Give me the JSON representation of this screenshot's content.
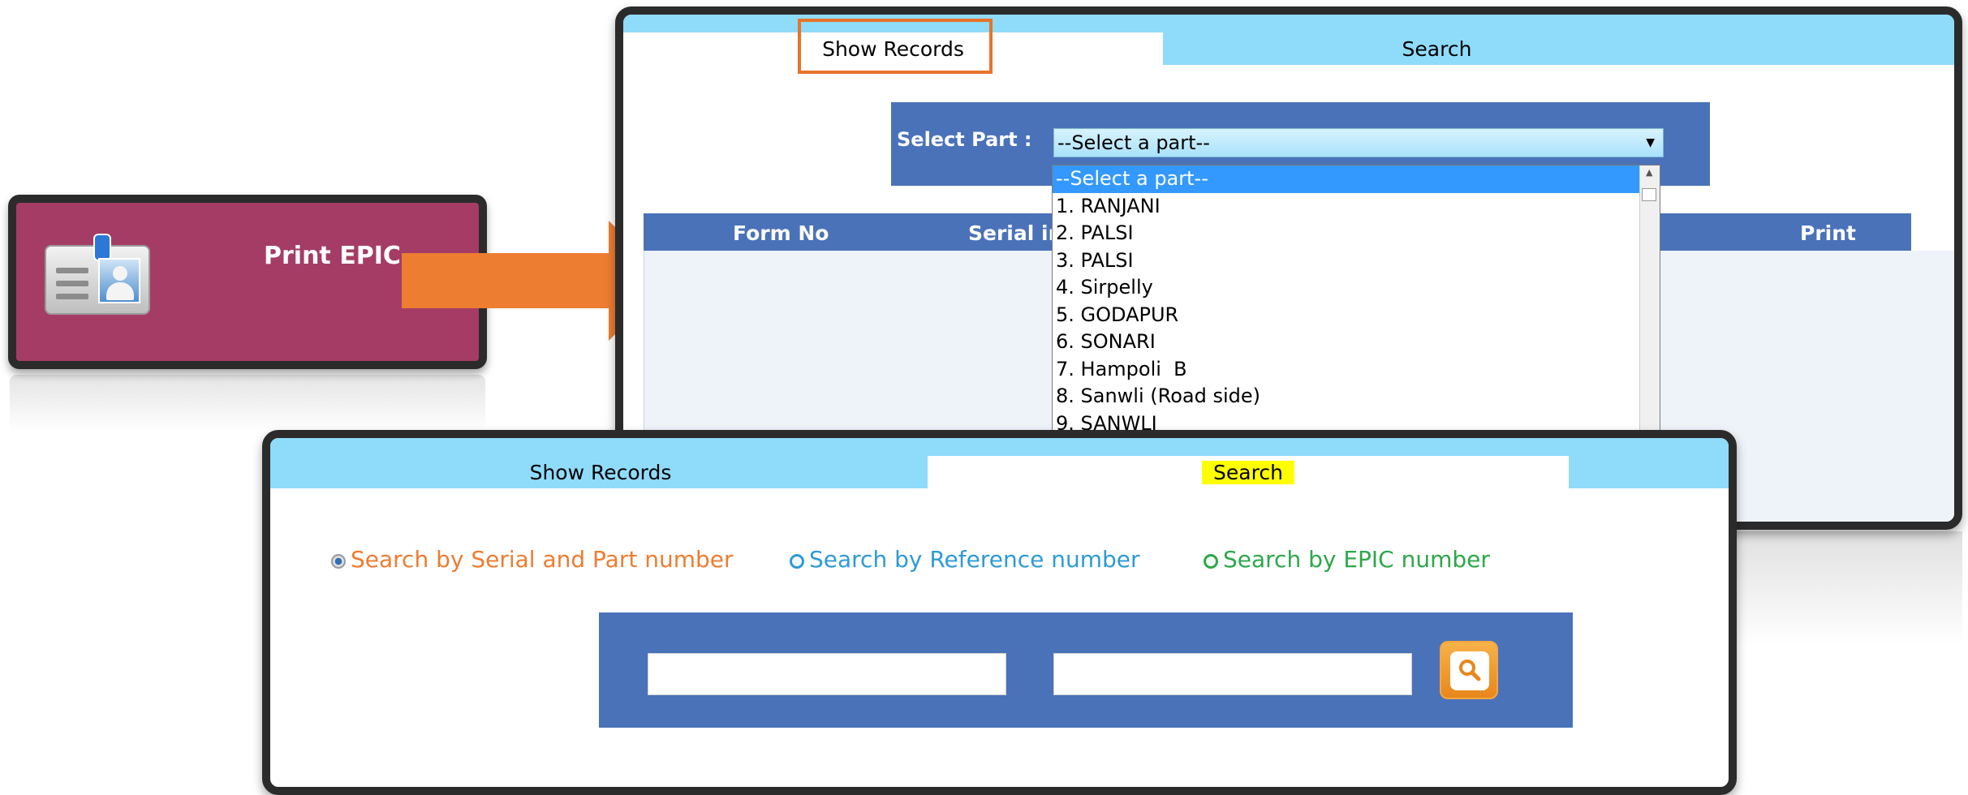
{
  "tile": {
    "title": "Print EPIC",
    "icon": "id-card-icon",
    "color": "#a53c66"
  },
  "arrow": {
    "icon": "arrow-right-icon",
    "color": "#ed7d31"
  },
  "top_panel": {
    "tabs": [
      {
        "label": "Show Records",
        "active": true
      },
      {
        "label": "Search",
        "active": false
      }
    ],
    "filter": {
      "label": "Select Part :",
      "selected": "--Select a part--",
      "options": [
        "--Select a part--",
        "1. RANJANI",
        "2. PALSI",
        "3. PALSI",
        "4. Sirpelly",
        "5. GODAPUR",
        "6. SONARI",
        "7. Hampoli  B",
        "8. Sanwli (Road side)",
        "9. SANWLI"
      ]
    },
    "table": {
      "columns": [
        "Form No",
        "Serial in",
        "Print"
      ]
    }
  },
  "bottom_panel": {
    "tabs": [
      {
        "label": "Show Records",
        "active": false
      },
      {
        "label": "Search",
        "active": true
      }
    ],
    "search_options": [
      {
        "label": "Search by Serial and Part number",
        "selected": true,
        "color": "#ed7d31"
      },
      {
        "label": "Search by Reference number",
        "selected": false,
        "color": "#2e9bd6"
      },
      {
        "label": "Search by EPIC number",
        "selected": false,
        "color": "#2da84a"
      }
    ],
    "inputs": [
      {
        "value": "",
        "placeholder": ""
      },
      {
        "value": "",
        "placeholder": ""
      }
    ],
    "search_button_icon": "search-icon"
  },
  "colors": {
    "tab_active": "#ffffff",
    "tab_inactive": "#8fdbfa",
    "header_blue": "#4a72b9",
    "highlight": "#ffff00",
    "callout": "#e8732a"
  }
}
